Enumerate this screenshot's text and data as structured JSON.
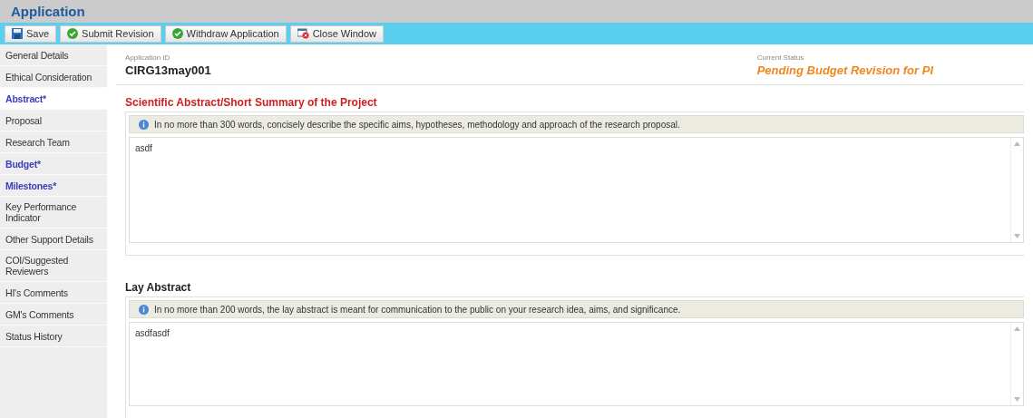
{
  "window": {
    "title": "Application"
  },
  "toolbar": [
    {
      "label": "Save",
      "kind": "save"
    },
    {
      "label": "Submit Revision",
      "kind": "ok"
    },
    {
      "label": "Withdraw Application",
      "kind": "ok"
    },
    {
      "label": "Close Window",
      "kind": "close"
    }
  ],
  "sidebar": {
    "items": [
      {
        "label": "General Details",
        "selected": false,
        "required": false
      },
      {
        "label": "Ethical Consideration",
        "selected": false,
        "required": false
      },
      {
        "label": "Abstract*",
        "selected": true,
        "required": true
      },
      {
        "label": "Proposal",
        "selected": false,
        "required": false
      },
      {
        "label": "Research Team",
        "selected": false,
        "required": false
      },
      {
        "label": "Budget*",
        "selected": false,
        "required": true
      },
      {
        "label": "Milestones*",
        "selected": false,
        "required": true
      },
      {
        "label": "Key Performance Indicator",
        "selected": false,
        "required": false
      },
      {
        "label": "Other Support Details",
        "selected": false,
        "required": false
      },
      {
        "label": "COI/Suggested Reviewers",
        "selected": false,
        "required": false
      },
      {
        "label": "HI's Comments",
        "selected": false,
        "required": false
      },
      {
        "label": "GM's Comments",
        "selected": false,
        "required": false
      },
      {
        "label": "Status History",
        "selected": false,
        "required": false
      }
    ]
  },
  "header": {
    "id_label": "Application ID",
    "id_value": "CIRG13may001",
    "status_label": "Current Status",
    "status_value": "Pending Budget Revision for PI"
  },
  "sections": [
    {
      "title": "Scientific Abstract/Short Summary of the Project",
      "highlighted": true,
      "info": "In no more than 300 words, concisely describe the specific aims, hypotheses, methodology and approach of the research proposal.",
      "value": "asdf"
    },
    {
      "title": "Lay Abstract",
      "highlighted": false,
      "info": "In no more than 200 words, the lay abstract is meant for communication to the public on your research idea, aims, and significance.",
      "value": "asdfasdf"
    }
  ]
}
